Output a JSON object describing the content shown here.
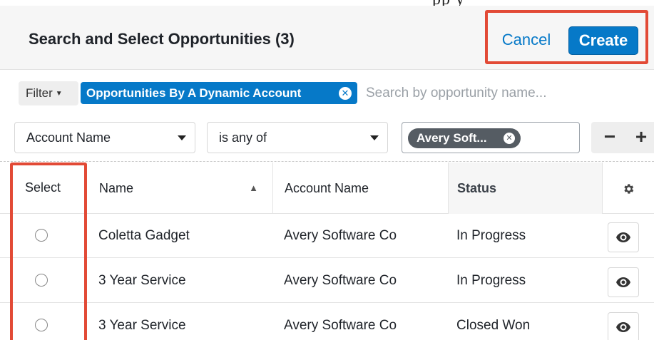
{
  "header": {
    "top_glyph": "pp y",
    "title": "Search and Select Opportunities (3)",
    "cancel_label": "Cancel",
    "create_label": "Create"
  },
  "filter_bar": {
    "filter_label": "Filter",
    "active_filter": "Opportunities By A Dynamic Account",
    "search_placeholder": "Search by opportunity name..."
  },
  "rule": {
    "field": "Account Name",
    "operator": "is any of",
    "value_pill": "Avery Soft...",
    "minus_label": "−",
    "plus_label": "+"
  },
  "table": {
    "columns": {
      "select": "Select",
      "name": "Name",
      "account": "Account Name",
      "status": "Status"
    },
    "rows": [
      {
        "name": "Coletta Gadget",
        "account": "Avery Software Co",
        "status": "In Progress"
      },
      {
        "name": "3 Year Service",
        "account": "Avery Software Co",
        "status": "In Progress"
      },
      {
        "name": "3 Year Service",
        "account": "Avery Software Co",
        "status": "Closed Won"
      }
    ]
  },
  "icons": {
    "filter_caret": "chevron-down-icon",
    "clear_filter": "close-circle-icon",
    "sort": "sort-icon",
    "settings": "gear-icon",
    "preview": "eye-icon"
  },
  "colors": {
    "accent": "#0679c8",
    "highlight": "#e24a36",
    "pill_dark": "#555c63"
  }
}
